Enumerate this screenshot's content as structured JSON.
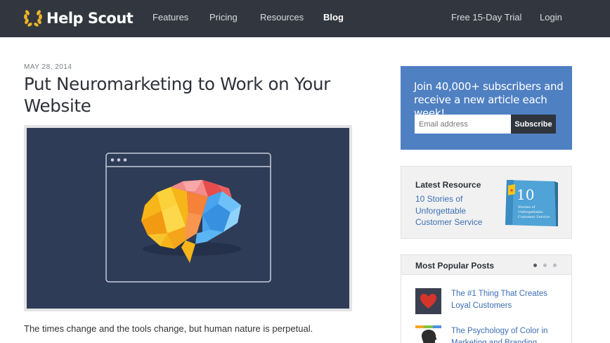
{
  "brand": {
    "name": "Help Scout"
  },
  "nav": {
    "features": "Features",
    "pricing": "Pricing",
    "resources": "Resources",
    "blog": "Blog",
    "trial": "Free 15-Day Trial",
    "login": "Login"
  },
  "article": {
    "date": "MAY 28, 2014",
    "title": "Put Neuromarketing to Work on Your Website",
    "intro": "The times change and the tools change, but human nature is perpetual."
  },
  "subscribe": {
    "text": "Join 40,000+ subscribers and receive a new article each week!",
    "placeholder": "Email address",
    "button": "Subscribe"
  },
  "resource": {
    "heading": "Latest Resource",
    "link": "10 Stories of Unforgettable Customer Service",
    "book_number": "10",
    "book_subtitle": "Stories of Unforgettable Customer Service"
  },
  "popular": {
    "heading": "Most Popular Posts",
    "posts": [
      {
        "title": "The #1 Thing That Creates Loyal Customers",
        "icon": "heart-icon"
      },
      {
        "title": "The Psychology of Color in Marketing and Branding",
        "icon": "head-icon"
      }
    ]
  },
  "colors": {
    "nav_bg": "#32373f",
    "accent_blue": "#4f80c2",
    "link_blue": "#3c6fb4",
    "hero_bg": "#2e3c57"
  }
}
